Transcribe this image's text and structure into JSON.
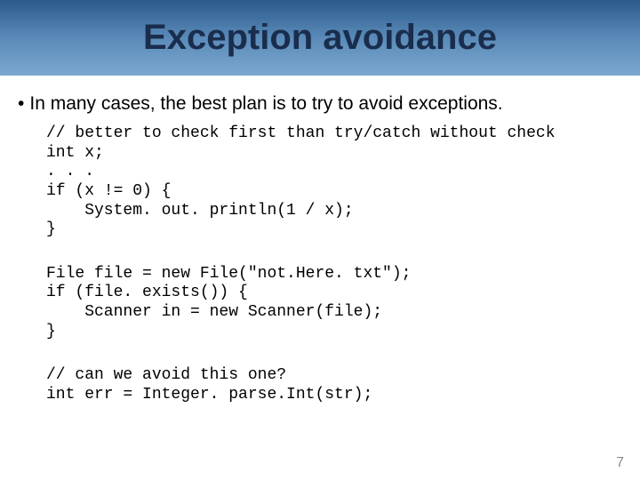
{
  "title": "Exception avoidance",
  "bullet": "In many cases, the best plan is to try to avoid exceptions.",
  "code1": "// better to check first than try/catch without check\nint x;\n. . .\nif (x != 0) {\n    System. out. println(1 / x);\n}",
  "code2": "File file = new File(\"not.Here. txt\");\nif (file. exists()) {\n    Scanner in = new Scanner(file);\n}",
  "code3": "// can we avoid this one?\nint err = Integer. parse.Int(str);",
  "page_number": "7"
}
